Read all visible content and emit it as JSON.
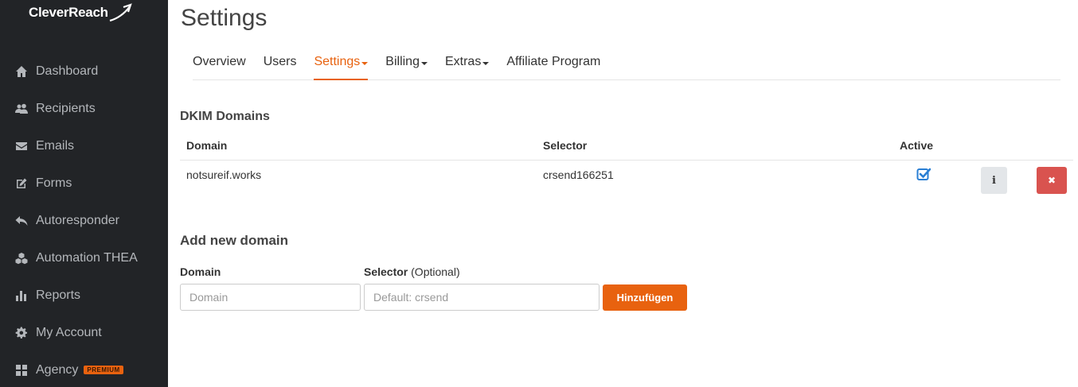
{
  "brand": {
    "name": "CleverReach",
    "accent": "#e8620f",
    "sidebar_bg": "#222427"
  },
  "sidebar": {
    "items": [
      {
        "label": "Dashboard",
        "icon": "home-icon"
      },
      {
        "label": "Recipients",
        "icon": "users-icon"
      },
      {
        "label": "Emails",
        "icon": "envelope-icon"
      },
      {
        "label": "Forms",
        "icon": "edit-icon"
      },
      {
        "label": "Autoresponder",
        "icon": "reply-icon"
      },
      {
        "label": "Automation THEA",
        "icon": "cubes-icon"
      },
      {
        "label": "Reports",
        "icon": "bar-chart-icon"
      },
      {
        "label": "My Account",
        "icon": "gear-icon"
      },
      {
        "label": "Agency",
        "icon": "grid-icon",
        "badge": "PREMIUM"
      }
    ]
  },
  "page": {
    "title": "Settings"
  },
  "tabs": [
    {
      "label": "Overview",
      "active": false,
      "dropdown": false
    },
    {
      "label": "Users",
      "active": false,
      "dropdown": false
    },
    {
      "label": "Settings",
      "active": true,
      "dropdown": true
    },
    {
      "label": "Billing",
      "active": false,
      "dropdown": true
    },
    {
      "label": "Extras",
      "active": false,
      "dropdown": true
    },
    {
      "label": "Affiliate Program",
      "active": false,
      "dropdown": false
    }
  ],
  "dkim": {
    "title": "DKIM Domains",
    "columns": {
      "domain": "Domain",
      "selector": "Selector",
      "active": "Active"
    },
    "rows": [
      {
        "domain": "notsureif.works",
        "selector": "crsend166251",
        "active": true
      }
    ]
  },
  "add_domain": {
    "title": "Add new domain",
    "domain_label": "Domain",
    "selector_label": "Selector",
    "selector_optional": "(Optional)",
    "domain_placeholder": "Domain",
    "selector_placeholder": "Default: crsend",
    "submit_label": "Hinzufügen"
  }
}
